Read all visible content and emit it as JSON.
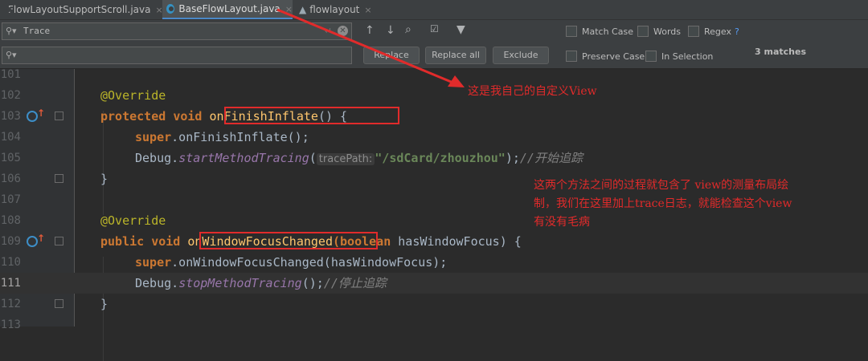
{
  "tabs": [
    {
      "label": "FlowLayoutSupportScroll.java",
      "close": "×"
    },
    {
      "label": "BaseFlowLayout.java",
      "close": "×"
    },
    {
      "label": "flowlayout",
      "close": "×"
    }
  ],
  "find": {
    "search_value": "Trace",
    "replace_value": "",
    "replace_label": "Replace",
    "replace_all_label": "Replace all",
    "exclude_label": "Exclude",
    "match_case_label": "Match Case",
    "words_label": "Words",
    "regex_label": "Regex",
    "regex_help": "?",
    "preserve_case_label": "Preserve Case",
    "in_selection_label": "In Selection",
    "matches_text": "3 matches"
  },
  "code": {
    "line_numbers": [
      "101",
      "102",
      "103",
      "104",
      "105",
      "106",
      "107",
      "108",
      "109",
      "110",
      "111",
      "112",
      "113"
    ],
    "override": "@Override",
    "protected": "protected",
    "void": "void",
    "public": "public",
    "finish_fn": "onFinishInflate",
    "finish_tail": "() {",
    "super_kw": "super",
    "finish_call": ".onFinishInflate();",
    "debug": "Debug.",
    "start_tracing": "startMethodTracing",
    "open_paren": "(",
    "hint_label": "tracePath:",
    "path_str": "\"/sdCard/zhouzhou\"",
    "close_stmt": ");",
    "start_comment": "//开始追踪",
    "close_brace": "}",
    "focus_fn": "onWindowFocusChanged",
    "focus_params_kw": "(boolean",
    "focus_params_rest": " hasWindowFocus) {",
    "focus_call": ".onWindowFocusChanged(hasWindowFocus);",
    "stop_tracing": "stopMethodTracing",
    "stop_tail": "();",
    "stop_comment": "//停止追踪"
  },
  "annotations": {
    "note_view": "这是我自己的自定义View",
    "note_process_1": "这两个方法之间的过程就包含了 view的测量布局绘",
    "note_process_2": "制，我们在这里加上trace日志，就能检查这个view",
    "note_process_3": "有没有毛病",
    "annotation_color": "#e12b2b"
  },
  "colors": {
    "keyword": "#cc7832",
    "function": "#ffc66d",
    "string": "#6a8759",
    "comment": "#808080",
    "annotation": "#bbb529"
  }
}
